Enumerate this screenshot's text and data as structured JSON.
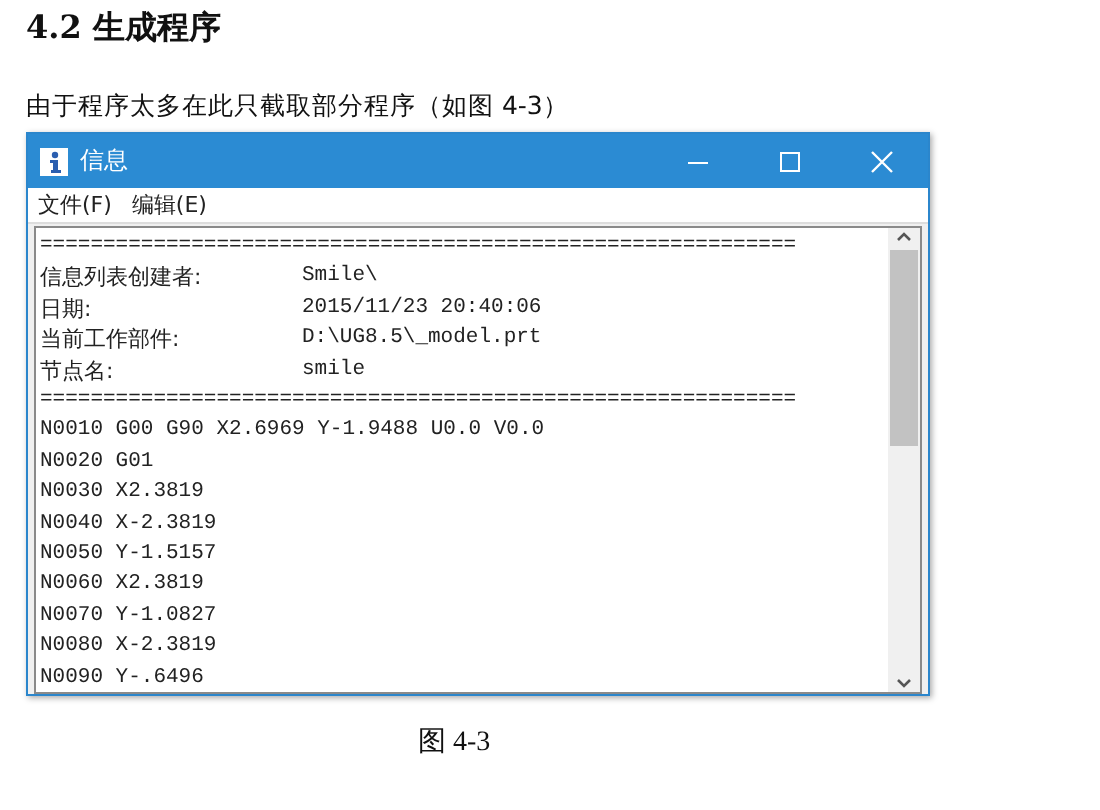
{
  "heading": "4.2 生成程序",
  "paragraph": "由于程序太多在此只截取部分程序（如图 4-3）",
  "window": {
    "title": "信息",
    "menu": [
      {
        "label": "文件(F)"
      },
      {
        "label": "编辑(E)"
      }
    ],
    "lines": [
      {
        "kind": "rule",
        "text": "============================================================"
      },
      {
        "kind": "field",
        "label": "信息列表创建者:",
        "value": "Smile\\"
      },
      {
        "kind": "field",
        "label": "日期:",
        "value": "2015/11/23 20:40:06"
      },
      {
        "kind": "field",
        "label": "当前工作部件:",
        "value": "D:\\UG8.5\\_model.prt"
      },
      {
        "kind": "field",
        "label": "节点名:",
        "value": "smile"
      },
      {
        "kind": "rule",
        "text": "============================================================"
      },
      {
        "kind": "code",
        "text": "N0010 G00 G90 X2.6969 Y-1.9488 U0.0 V0.0"
      },
      {
        "kind": "code",
        "text": "N0020 G01"
      },
      {
        "kind": "code",
        "text": "N0030 X2.3819"
      },
      {
        "kind": "code",
        "text": "N0040 X-2.3819"
      },
      {
        "kind": "code",
        "text": "N0050 Y-1.5157"
      },
      {
        "kind": "code",
        "text": "N0060 X2.3819"
      },
      {
        "kind": "code",
        "text": "N0070 Y-1.0827"
      },
      {
        "kind": "code",
        "text": "N0080 X-2.3819"
      },
      {
        "kind": "code",
        "text": "N0090 Y-.6496"
      }
    ]
  },
  "caption": "图 4-3"
}
